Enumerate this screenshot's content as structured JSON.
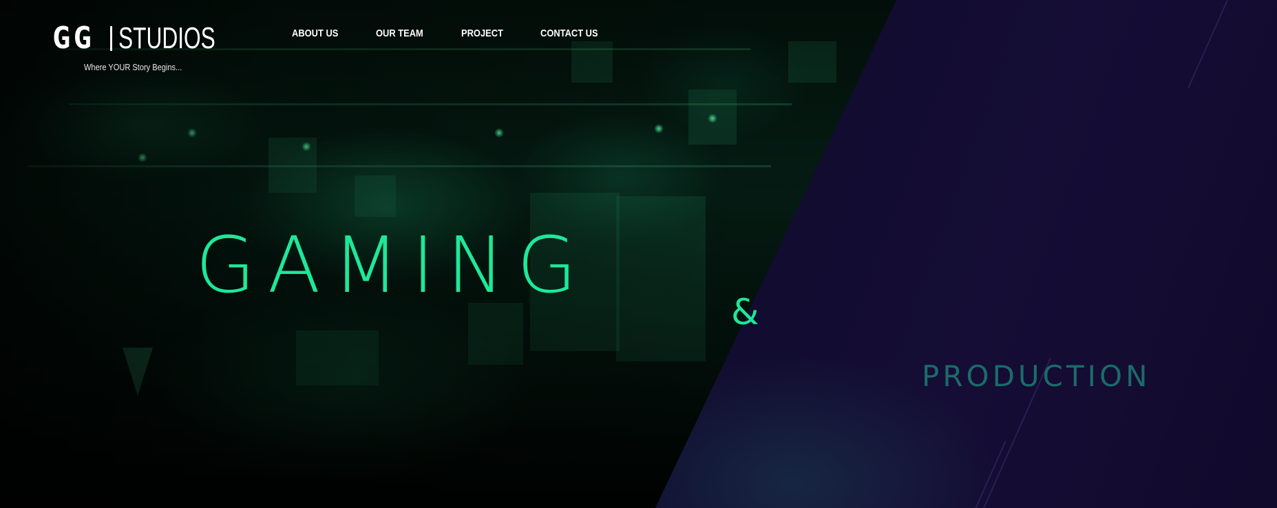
{
  "logo": {
    "gg": "GG",
    "studios": "STUDIOS",
    "tagline": "Where YOUR Story Begins..."
  },
  "nav": {
    "items": [
      {
        "label": "ABOUT US"
      },
      {
        "label": "OUR TEAM"
      },
      {
        "label": "PROJECT"
      },
      {
        "label": "CONTACT US"
      }
    ]
  },
  "hero": {
    "line1": "GAMING",
    "amp": "&",
    "line2": "PRODUCTION"
  },
  "colors": {
    "accent": "#1de89a",
    "production_text": "#1b6b6a",
    "panel": "#120d30"
  }
}
